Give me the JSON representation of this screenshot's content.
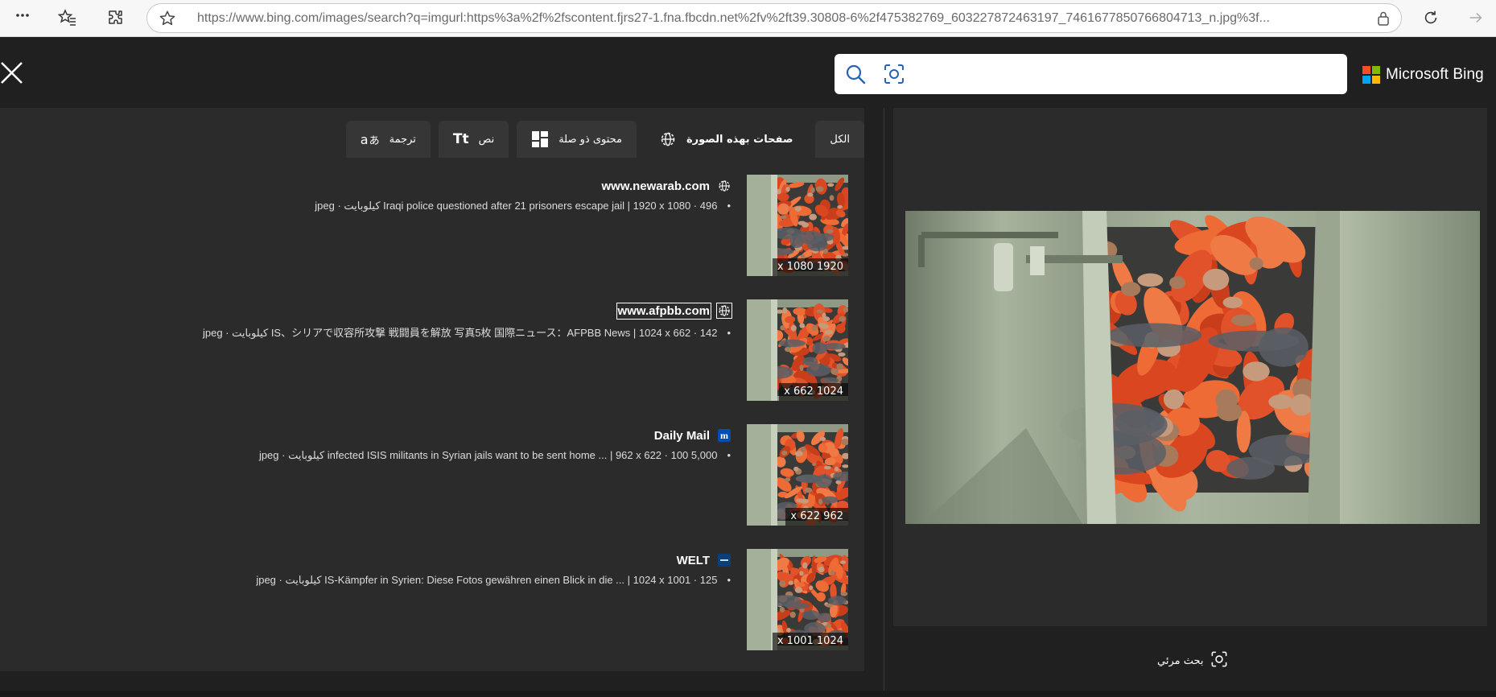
{
  "browser": {
    "url": "https://www.bing.com/images/search?q=imgurl:https%3a%2f%2fscontent.fjrs27-1.fna.fbcdn.net%2fv%2ft39.30808-6%2f475382769_603227872463197_7461677850766804713_n.jpg%3f...",
    "icons": [
      "more-icon",
      "favorites-icon",
      "extensions-icon",
      "star-icon",
      "lock-icon",
      "refresh-icon",
      "forward-icon"
    ]
  },
  "header": {
    "brand": "Microsoft Bing",
    "search_placeholder": "",
    "logo_colors": [
      "#f25022",
      "#7fba00",
      "#00a4ef",
      "#ffb900"
    ]
  },
  "tabs": [
    {
      "label": "الكل",
      "icon": "",
      "active": false
    },
    {
      "label": "صفحات بهذه الصورة",
      "icon": "globe-icon",
      "active": true
    },
    {
      "label": "محتوى ذو صلة",
      "icon": "grid-icon",
      "active": false
    },
    {
      "label": "نص",
      "icon": "text-icon",
      "active": false
    },
    {
      "label": "ترجمة",
      "icon": "translate-icon",
      "active": false
    }
  ],
  "results": [
    {
      "site": "www.newarab.com",
      "favicon": "globe-icon",
      "description": "jpeg · كيلوبايت Iraqi police questioned after 21 prisoners escape jail | 1920 x 1080 · 496",
      "dims": "x 1080 1920",
      "boxed": false
    },
    {
      "site": "www.afpbb.com",
      "favicon": "globe-icon",
      "description": "jpeg · كيلوبايت IS、シリアで収容所攻撃 戦闘員を解放 写真5枚 国際ニュース：AFPBB News | 1024 x 662 · 142",
      "dims": "x 662 1024",
      "boxed": true
    },
    {
      "site": "Daily Mail",
      "favicon": "dailymail-icon",
      "description": "jpeg · كيلوبايت infected ISIS militants in Syrian jails want to be sent home ... | 962 x 622 · 100 5,000",
      "dims": "x 622 962",
      "boxed": false
    },
    {
      "site": "WELT",
      "favicon": "welt-icon",
      "description": "jpeg · كيلوبايت IS-Kämpfer in Syrien: Diese Fotos gewähren einen Blick in die ... | 1024 x 1001 · 125",
      "dims": "x 1001 1024",
      "boxed": false
    }
  ],
  "preview": {
    "visual_search_label": "بحث مرئي"
  }
}
